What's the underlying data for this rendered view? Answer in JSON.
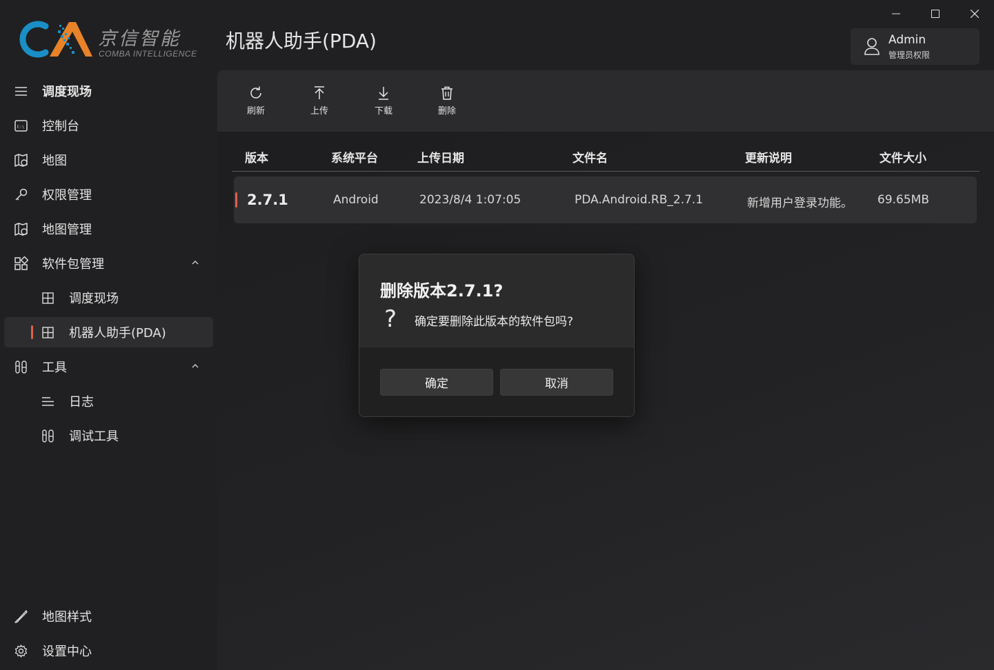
{
  "logo": {
    "text_cn": "京信智能",
    "text_en": "COMBA INTELLIGENCE"
  },
  "app_title": "机器人助手(PDA)",
  "window_controls": {
    "minimize": "—",
    "maximize": "☐",
    "close": "✕"
  },
  "user": {
    "name": "Admin",
    "role": "管理员权限"
  },
  "sidebar": {
    "items": [
      {
        "label": "调度现场",
        "icon": "hamburger-icon"
      },
      {
        "label": "控制台",
        "icon": "console-icon"
      },
      {
        "label": "地图",
        "icon": "map-icon"
      },
      {
        "label": "权限管理",
        "icon": "key-icon"
      },
      {
        "label": "地图管理",
        "icon": "map-settings-icon"
      },
      {
        "label": "软件包管理",
        "icon": "package-icon",
        "expanded": true,
        "children": [
          {
            "label": "调度现场",
            "icon": "package-item-icon"
          },
          {
            "label": "机器人助手(PDA)",
            "icon": "package-item-icon",
            "active": true
          }
        ]
      },
      {
        "label": "工具",
        "icon": "tools-icon",
        "expanded": true,
        "children": [
          {
            "label": "日志",
            "icon": "log-icon"
          },
          {
            "label": "调试工具",
            "icon": "debug-tools-icon"
          }
        ]
      }
    ],
    "footer_items": [
      {
        "label": "地图样式",
        "icon": "brush-icon"
      },
      {
        "label": "设置中心",
        "icon": "gear-icon"
      }
    ]
  },
  "toolbar": {
    "refresh": "刷新",
    "upload": "上传",
    "download": "下载",
    "delete": "删除"
  },
  "table": {
    "columns": [
      "版本",
      "系统平台",
      "上传日期",
      "文件名",
      "更新说明",
      "文件大小"
    ],
    "rows": [
      {
        "version": "2.7.1",
        "platform": "Android",
        "date": "2023/8/4 1:07:05",
        "filename": "PDA.Android.RB_2.7.1",
        "notes": "新增用户登录功能。",
        "size": "69.65MB"
      }
    ]
  },
  "dialog": {
    "title": "删除版本2.7.1?",
    "message": "确定要删除此版本的软件包吗?",
    "confirm": "确定",
    "cancel": "取消"
  },
  "colors": {
    "accent": "#e05f4e",
    "logo_blue": "#1a8fc6",
    "logo_orange": "#e8832a"
  }
}
